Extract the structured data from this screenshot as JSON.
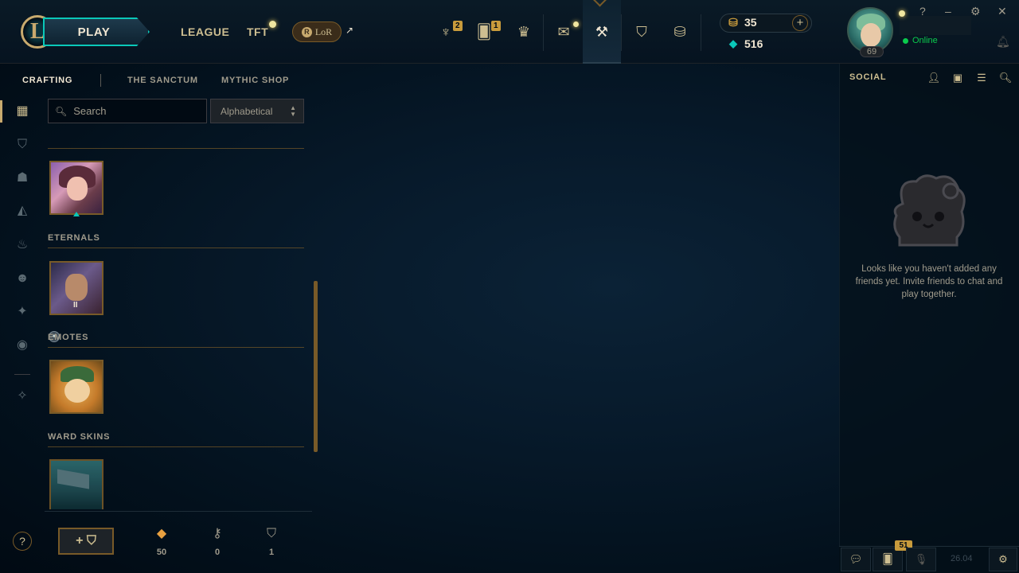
{
  "topbar": {
    "play_label": "PLAY",
    "nav": {
      "league": "LEAGUE",
      "tft": "TFT",
      "lor": "LoR",
      "lor_mark": "R"
    },
    "icons": [
      {
        "name": "trophy-icon",
        "glyph": "♆",
        "badge": "2"
      },
      {
        "name": "missions-icon",
        "glyph": "🂠",
        "badge": "1"
      },
      {
        "name": "ranked-icon",
        "glyph": "♛",
        "badge": ""
      },
      {
        "name": "inbox-icon",
        "glyph": "✉",
        "badge": ""
      },
      {
        "name": "crafting-hammer-icon",
        "glyph": "⚒",
        "badge": ""
      },
      {
        "name": "collection-icon",
        "glyph": "⛉",
        "badge": ""
      },
      {
        "name": "store-coins-icon",
        "glyph": "⛁",
        "badge": ""
      }
    ],
    "currency": {
      "rp": "35",
      "blue_essence": "516"
    },
    "profile": {
      "level": "69",
      "status": "Online"
    },
    "window_controls": {
      "help": "?",
      "minimize": "–",
      "settings": "⚙",
      "close": "✕"
    }
  },
  "rail": {
    "items": [
      {
        "name": "all-loot-icon",
        "glyph": "▦"
      },
      {
        "name": "chests-icon",
        "glyph": "⛉"
      },
      {
        "name": "champions-icon",
        "glyph": "☗"
      },
      {
        "name": "skins-icon",
        "glyph": "◭"
      },
      {
        "name": "wards-icon",
        "glyph": "♨"
      },
      {
        "name": "emotes-icon",
        "glyph": "☻"
      },
      {
        "name": "eternals-icon",
        "glyph": "✦"
      },
      {
        "name": "icons-icon",
        "glyph": "◉"
      },
      {
        "name": "materials-icon",
        "glyph": "✧"
      }
    ],
    "help": "?"
  },
  "crafting": {
    "tabs": [
      "CRAFTING",
      "THE SANCTUM",
      "MYTHIC SHOP"
    ],
    "search": {
      "placeholder": "Search",
      "value": ""
    },
    "sort": {
      "selected": "Alphabetical"
    },
    "sections": {
      "eternals": "ETERNALS",
      "emotes": "EMOTES",
      "ward_skins": "WARD SKINS"
    },
    "eternal_tier": "II",
    "bottom": {
      "add_label": "+ ⛉",
      "resources": [
        {
          "name": "orange-essence-icon",
          "glyph": "◆",
          "value": "50",
          "color": "#e8a040"
        },
        {
          "name": "key-icon",
          "glyph": "⚷",
          "value": "0",
          "color": "#a09b8c"
        },
        {
          "name": "chest-icon",
          "glyph": "⛉",
          "value": "1",
          "color": "#a09b8c"
        }
      ]
    }
  },
  "social": {
    "title": "SOCIAL",
    "empty_message": "Looks like you haven't added any friends yet. Invite friends to chat and play together.",
    "bottom": {
      "notifications_count": "51",
      "version": "26.04"
    }
  }
}
